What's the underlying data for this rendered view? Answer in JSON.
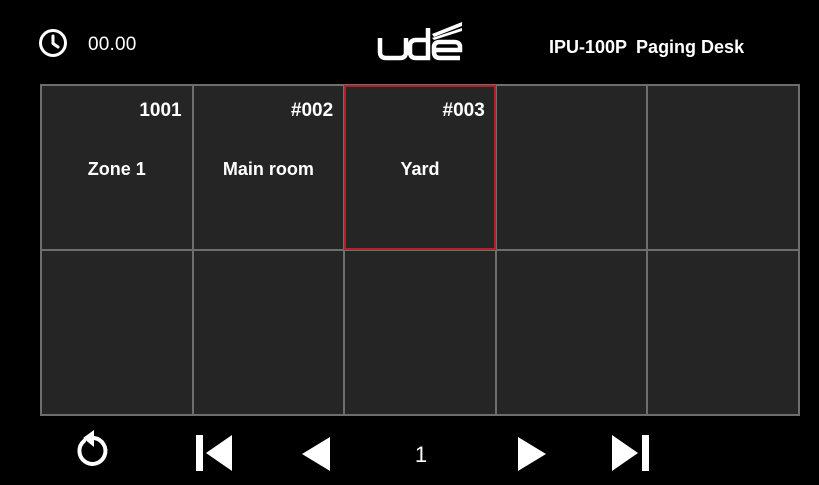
{
  "header": {
    "clock_icon": "clock-icon",
    "time": "00.00",
    "logo_text": "ude",
    "model": "IPU-100P",
    "title": "Paging Desk"
  },
  "zones": [
    {
      "number": "1001",
      "name": "Zone 1",
      "selected": false
    },
    {
      "number": "#002",
      "name": "Main room",
      "selected": false
    },
    {
      "number": "#003",
      "name": "Yard",
      "selected": true
    },
    {
      "number": "",
      "name": "",
      "selected": false
    },
    {
      "number": "",
      "name": "",
      "selected": false
    },
    {
      "number": "",
      "name": "",
      "selected": false
    },
    {
      "number": "",
      "name": "",
      "selected": false
    },
    {
      "number": "",
      "name": "",
      "selected": false
    },
    {
      "number": "",
      "name": "",
      "selected": false
    },
    {
      "number": "",
      "name": "",
      "selected": false
    }
  ],
  "footer": {
    "back_icon": "refresh-back-icon",
    "first_icon": "skip-first-icon",
    "prev_icon": "previous-icon",
    "page": "1",
    "next_icon": "next-icon",
    "last_icon": "skip-last-icon"
  },
  "colors": {
    "background": "#000000",
    "tile": "#252525",
    "grid_line": "#6e6e6e",
    "selected_border": "#b5202a",
    "text": "#ffffff"
  }
}
